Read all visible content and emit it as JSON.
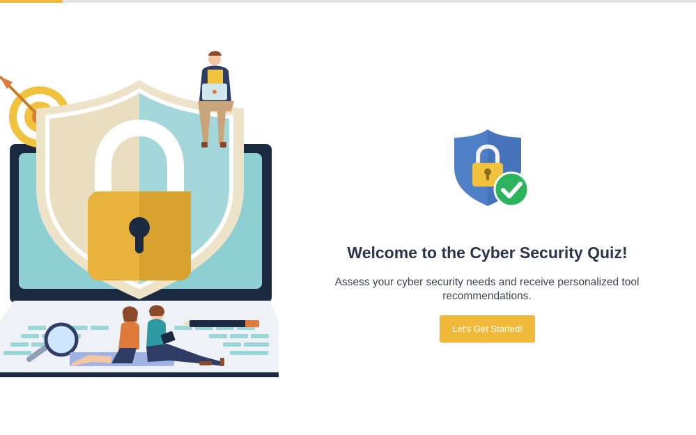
{
  "progress": {
    "fraction": 0.09
  },
  "hero": {
    "illustration": "cyber-security-laptop-shield-lock-illustration"
  },
  "badge": {
    "icon": "shield-lock-check-icon"
  },
  "welcome": {
    "title": "Welcome to the Cyber Security Quiz!",
    "subtitle": "Assess your cyber security needs and receive personalized tool recommendations.",
    "cta_label": "Let's Get Started!"
  },
  "colors": {
    "accent": "#f0b93a",
    "title": "#2c3447",
    "shield_blue": "#4f7fc7",
    "check_green": "#2db35d"
  }
}
